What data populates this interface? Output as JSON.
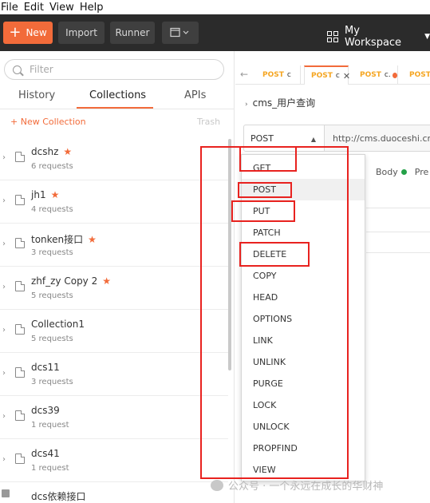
{
  "menu": [
    "File",
    "Edit",
    "View",
    "Help"
  ],
  "toolbar": {
    "new_label": "New",
    "import_label": "Import",
    "runner_label": "Runner",
    "workspace_label": "My Workspace"
  },
  "sidebar": {
    "search_placeholder": "Filter",
    "tabs": [
      "History",
      "Collections",
      "APIs"
    ],
    "active_tab": "Collections",
    "new_collection_label": "+ New Collection",
    "trash_label": "Trash",
    "collections": [
      {
        "name": "dcshz",
        "count": "6 requests",
        "starred": true
      },
      {
        "name": "jh1",
        "count": "4 requests",
        "starred": true
      },
      {
        "name": "tonken接口",
        "count": "3 requests",
        "starred": true
      },
      {
        "name": "zhf_zy Copy 2",
        "count": "5 requests",
        "starred": true
      },
      {
        "name": "Collection1",
        "count": "5 requests",
        "starred": false
      },
      {
        "name": "dcs11",
        "count": "3 requests",
        "starred": false
      },
      {
        "name": "dcs39",
        "count": "1 request",
        "starred": false
      },
      {
        "name": "dcs41",
        "count": "1 request",
        "starred": false
      }
    ],
    "partial_item": "dcs依赖接口"
  },
  "request": {
    "tabs": [
      {
        "method": "POST",
        "name": "c"
      },
      {
        "method": "POST",
        "name": "c"
      },
      {
        "method": "POST",
        "name": "c."
      },
      {
        "method": "POST",
        "name": ""
      }
    ],
    "name": "cms_用户查询",
    "method": "POST",
    "url": "http://cms.duoceshi.cn/c",
    "subtabs": {
      "body": "Body",
      "pre": "Pre"
    }
  },
  "method_dropdown": {
    "options": [
      "GET",
      "POST",
      "PUT",
      "PATCH",
      "DELETE",
      "COPY",
      "HEAD",
      "OPTIONS",
      "LINK",
      "UNLINK",
      "PURGE",
      "LOCK",
      "UNLOCK",
      "PROPFIND",
      "VIEW"
    ],
    "highlighted": "POST"
  },
  "watermark": "公众号 · 一个永远在成长的华财神",
  "colors": {
    "accent": "#f26b3a",
    "annotation": "#e8221f",
    "toolbar_bg": "#2b2b2b",
    "status_green": "#24a148"
  }
}
